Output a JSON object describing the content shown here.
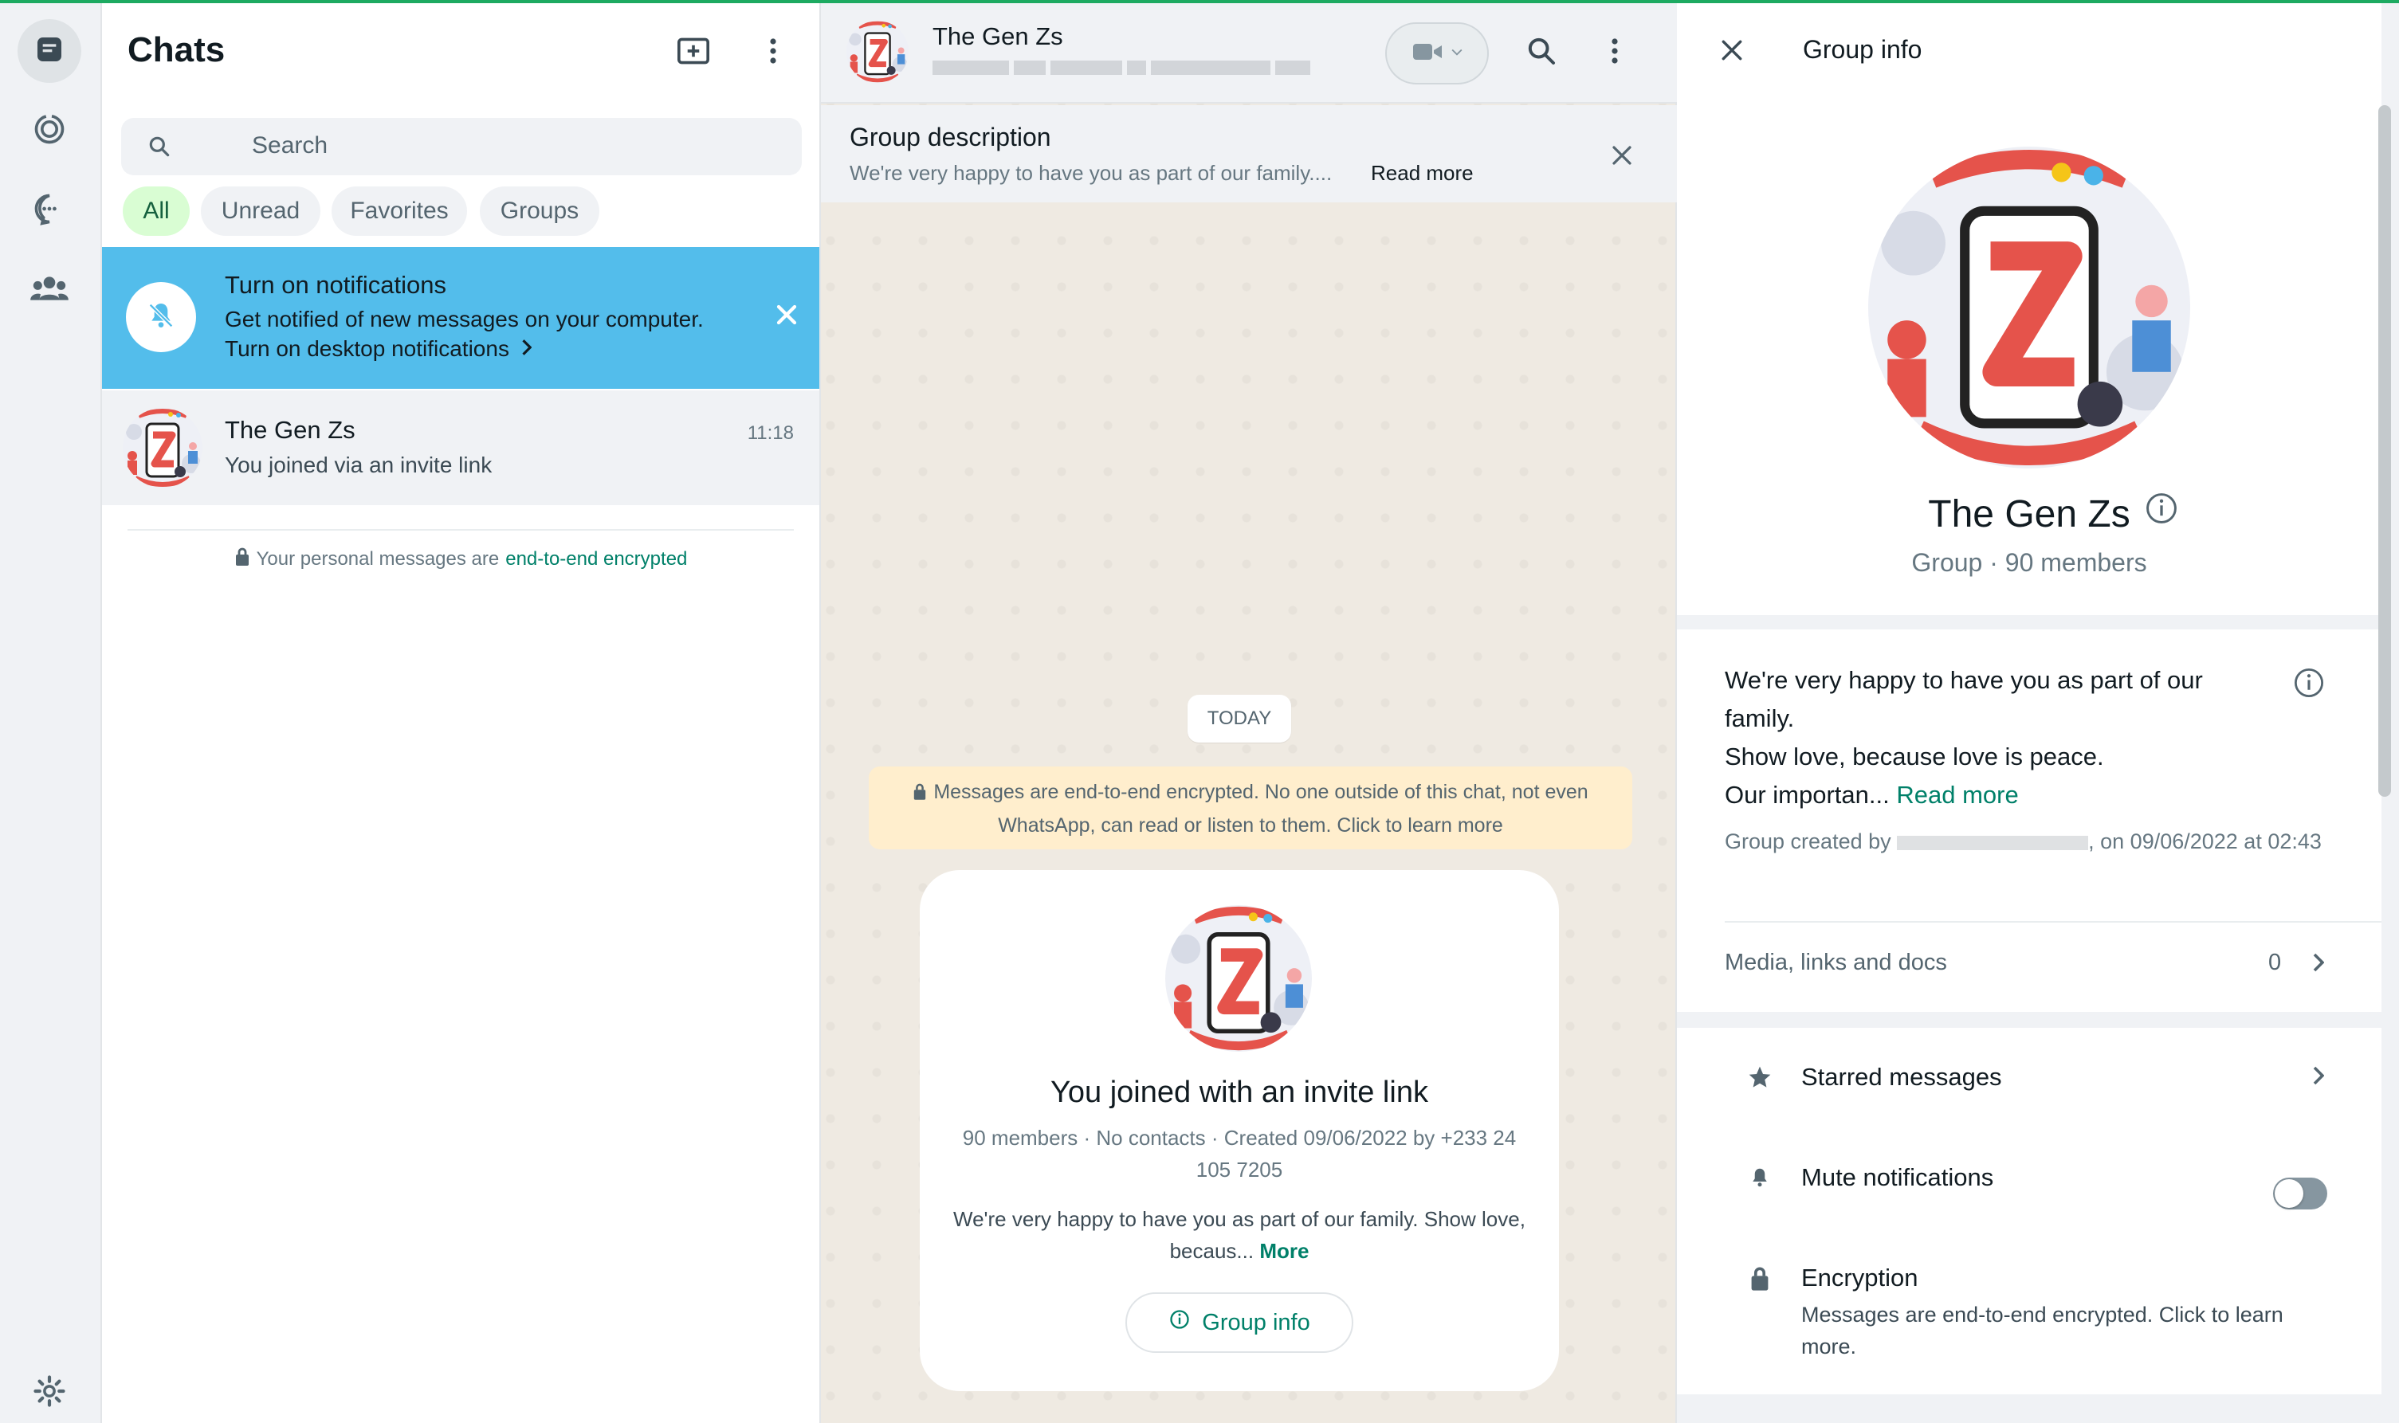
{
  "sidebar": {
    "icons": [
      "chats-icon",
      "status-icon",
      "channels-icon",
      "communities-icon",
      "settings-icon"
    ]
  },
  "chat_list": {
    "title": "Chats",
    "search_placeholder": "Search",
    "filters": [
      "All",
      "Unread",
      "Favorites",
      "Groups"
    ],
    "active_filter": "All",
    "notification": {
      "title": "Turn on notifications",
      "subtitle": "Get notified of new messages on your computer.",
      "link": "Turn on desktop notifications"
    },
    "chats": [
      {
        "name": "The Gen Zs",
        "time": "11:18",
        "last_message": "You joined via an invite link"
      }
    ],
    "encryption_prefix": "Your personal messages are",
    "encryption_link": "end-to-end encrypted"
  },
  "conversation": {
    "title": "The Gen Zs",
    "group_description": {
      "title": "Group description",
      "text": "We're very happy to have you as part of our family....",
      "read_more": "Read more"
    },
    "date_divider": "TODAY",
    "system_message": "Messages are end-to-end encrypted. No one outside of this chat, not even WhatsApp, can read or listen to them. Click to learn more",
    "invite_card": {
      "title": "You joined with an invite link",
      "meta": "90 members · No contacts · Created 09/06/2022 by +233 24 105 7205",
      "description": "We're very happy to have you as part of our family. Show love, becaus...",
      "more": "More",
      "button": "Group info"
    }
  },
  "group_info": {
    "header": "Group info",
    "name": "The Gen Zs",
    "subtitle": "Group · 90 members",
    "description_line1": "We're very happy to have you as part of our family.",
    "description_line2": "Show love, because love is peace.",
    "description_line3": "Our importan...",
    "read_more": "Read more",
    "created_prefix": "Group created by",
    "created_suffix": ", on 09/06/2022 at 02:43",
    "media_label": "Media, links and docs",
    "media_count": "0",
    "starred": "Starred messages",
    "mute": "Mute notifications",
    "mute_enabled": false,
    "encryption_title": "Encryption",
    "encryption_sub": "Messages are end-to-end encrypted. Click to learn more."
  },
  "colors": {
    "accent": "#008069",
    "notification_bg": "#53bdeb",
    "active_chip_bg": "#d9fdd3",
    "system_message_bg": "#ffeecd"
  }
}
